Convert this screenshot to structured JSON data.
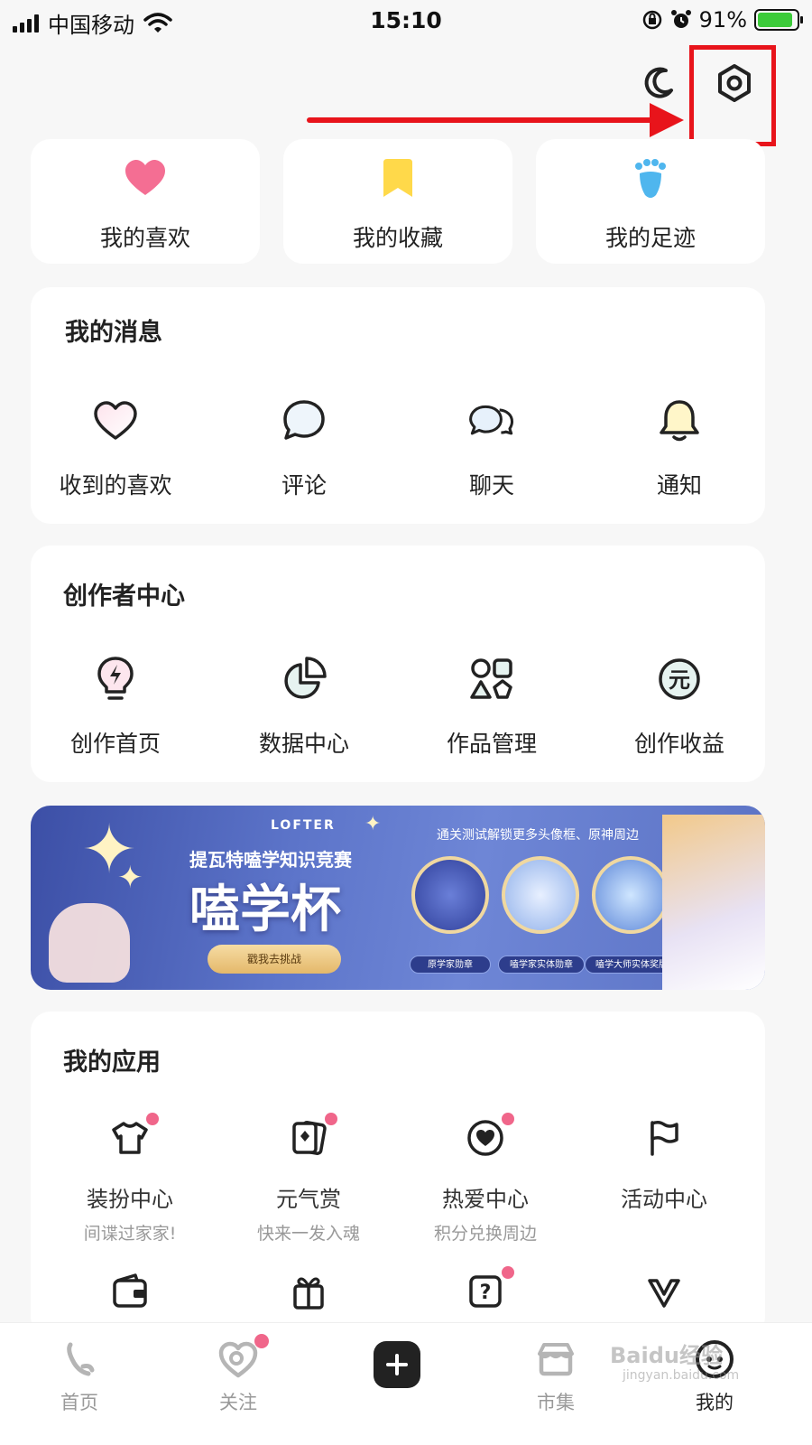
{
  "status_bar": {
    "carrier": "中国移动",
    "time": "15:10",
    "battery": "91%"
  },
  "quick_links": [
    {
      "label": "我的喜欢",
      "icon": "heart-icon"
    },
    {
      "label": "我的收藏",
      "icon": "bookmark-icon"
    },
    {
      "label": "我的足迹",
      "icon": "footprint-icon"
    }
  ],
  "messages": {
    "title": "我的消息",
    "items": [
      {
        "label": "收到的喜欢",
        "icon": "heart-outline-icon"
      },
      {
        "label": "评论",
        "icon": "comment-icon"
      },
      {
        "label": "聊天",
        "icon": "chat-icon"
      },
      {
        "label": "通知",
        "icon": "bell-icon"
      }
    ]
  },
  "creator": {
    "title": "创作者中心",
    "items": [
      {
        "label": "创作首页",
        "icon": "lightbulb-icon"
      },
      {
        "label": "数据中心",
        "icon": "pie-chart-icon"
      },
      {
        "label": "作品管理",
        "icon": "shapes-grid-icon"
      },
      {
        "label": "创作收益",
        "icon": "yuan-coin-icon"
      }
    ]
  },
  "banner": {
    "brand": "LOFTER",
    "subtitle": "提瓦特嗑学知识竞赛",
    "title": "嗑学杯",
    "button": "戳我去挑战",
    "promo": "通关测试解锁更多头像框、原神周边",
    "badges": [
      "原学家勋章",
      "嗑学家实体勋章",
      "嗑学大师实体奖牌"
    ]
  },
  "apps": {
    "title": "我的应用",
    "items": [
      {
        "label": "装扮中心",
        "sub": "间谍过家家!",
        "icon": "tshirt-icon",
        "dot": true
      },
      {
        "label": "元气赏",
        "sub": "快来一发入魂",
        "icon": "cards-icon",
        "dot": true
      },
      {
        "label": "热爱中心",
        "sub": "积分兑换周边",
        "icon": "heart-circle-icon",
        "dot": true
      },
      {
        "label": "活动中心",
        "sub": "",
        "icon": "flag-icon",
        "dot": false
      }
    ],
    "row2": [
      {
        "icon": "wallet-icon",
        "dot": false
      },
      {
        "icon": "gift-icon",
        "dot": false
      },
      {
        "icon": "help-icon",
        "dot": true
      },
      {
        "icon": "v-logo-icon",
        "dot": false
      }
    ]
  },
  "bottom_nav": [
    {
      "label": "首页",
      "icon": "home-icon"
    },
    {
      "label": "关注",
      "icon": "follow-icon"
    },
    {
      "label": "市集",
      "icon": "market-icon"
    },
    {
      "label": "我的",
      "icon": "profile-icon"
    }
  ],
  "watermark": {
    "main": "Baidu经验",
    "sub": "jingyan.baidu.com"
  },
  "colors": {
    "accent_red": "#e8141b",
    "pink": "#f0668a",
    "yellow": "#ffd94a",
    "blue": "#4fb6ee"
  }
}
